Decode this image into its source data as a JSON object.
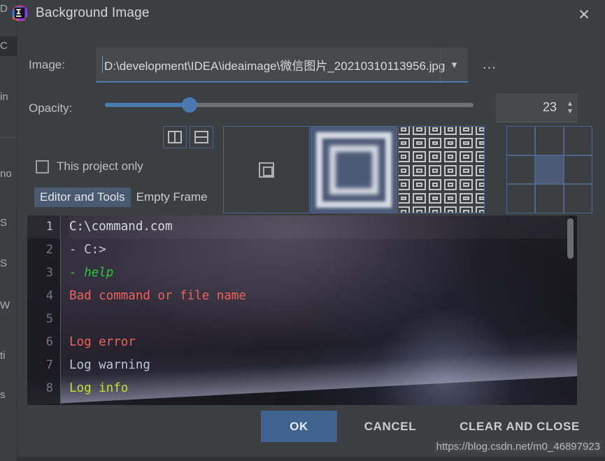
{
  "window": {
    "title": "Background Image",
    "logo_icon": "intellij-idea-logo",
    "close_icon": "close-icon"
  },
  "background_ide": {
    "fragments": [
      "D",
      "C",
      "in",
      "no",
      "S",
      "S",
      "W",
      "ti",
      "s"
    ]
  },
  "form": {
    "image_label": "Image:",
    "image_path": "D:\\development\\IDEA\\ideaimage\\微信图片_20210310113956.jpg",
    "image_dropdown_icon": "chevron-down-icon",
    "browse_label": "...",
    "opacity_label": "Opacity:",
    "opacity_value": "23",
    "opacity_percent": 23,
    "spinner_up_icon": "chevron-up-icon",
    "spinner_down_icon": "chevron-down-icon"
  },
  "layout_toggles": [
    {
      "icon": "split-vertical-icon",
      "selected": false
    },
    {
      "icon": "split-horizontal-icon",
      "selected": false
    }
  ],
  "project_only": {
    "label": "This project only",
    "checked": false
  },
  "tabs": [
    {
      "label": "Editor and Tools",
      "active": true
    },
    {
      "label": "Empty Frame",
      "active": false
    }
  ],
  "fill_modes": [
    {
      "name": "center",
      "icon": "center-square-icon",
      "selected": false
    },
    {
      "name": "scale",
      "icon": "scale-preview-icon",
      "selected": true
    },
    {
      "name": "tile",
      "icon": "tile-preview-icon",
      "selected": false
    }
  ],
  "anchor_grid": {
    "cells": [
      {
        "position": "top-left",
        "selected": false
      },
      {
        "position": "top-center",
        "selected": false
      },
      {
        "position": "top-right",
        "selected": false
      },
      {
        "position": "middle-left",
        "selected": false
      },
      {
        "position": "middle-center",
        "selected": true
      },
      {
        "position": "middle-right",
        "selected": false
      },
      {
        "position": "bottom-left",
        "selected": false
      },
      {
        "position": "bottom-center",
        "selected": false
      },
      {
        "position": "bottom-right",
        "selected": false
      }
    ]
  },
  "code_preview": {
    "lines": [
      {
        "num": "1",
        "text": "C:\\command.com",
        "color": "#d7dbe0",
        "current": true,
        "italic": false
      },
      {
        "num": "2",
        "text": "- C:>",
        "color": "#c6cad0",
        "current": false,
        "italic": false
      },
      {
        "num": "3",
        "text": "- help",
        "color": "#2ec43a",
        "current": false,
        "italic": true
      },
      {
        "num": "4",
        "text": "Bad command or file name",
        "color": "#f0605c",
        "current": false,
        "italic": false
      },
      {
        "num": "5",
        "text": "",
        "color": "#c6cad0",
        "current": false,
        "italic": false
      },
      {
        "num": "6",
        "text": "Log error",
        "color": "#f0605c",
        "current": false,
        "italic": false
      },
      {
        "num": "7",
        "text": "Log warning",
        "color": "#b9c6d6",
        "current": false,
        "italic": false
      },
      {
        "num": "8",
        "text": "Log info",
        "color": "#c5e02a",
        "current": false,
        "italic": false
      }
    ],
    "scrollbar_icon": "vertical-scrollbar"
  },
  "footer": {
    "ok_label": "OK",
    "cancel_label": "CANCEL",
    "clear_label": "CLEAR AND CLOSE"
  },
  "watermark": "https://blog.csdn.net/m0_46897923",
  "colors": {
    "dialog_bg": "#3c3f41",
    "accent_blue": "#4a78b0",
    "primary_button": "#3f628f",
    "selection_blue": "#4c5a78",
    "border_blue": "#4d6587",
    "text": "#bcc0c4"
  }
}
